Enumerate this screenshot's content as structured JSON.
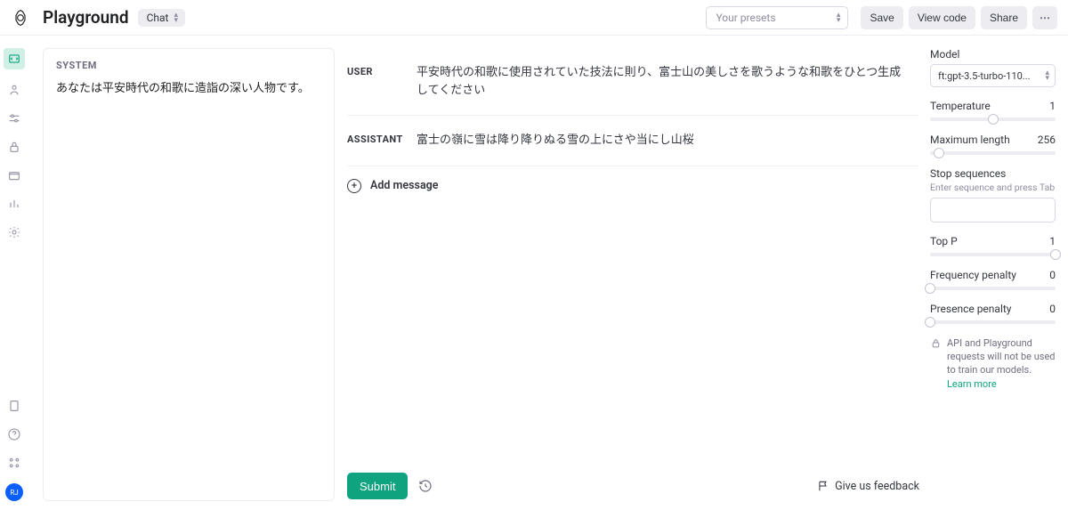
{
  "header": {
    "title": "Playground",
    "mode_label": "Chat",
    "preset_placeholder": "Your presets",
    "save_label": "Save",
    "view_code_label": "View code",
    "share_label": "Share"
  },
  "system": {
    "label": "SYSTEM",
    "text": "あなたは平安時代の和歌に造詣の深い人物です。"
  },
  "messages": [
    {
      "role": "USER",
      "text": "平安時代の和歌に使用されていた技法に則り、富士山の美しさを歌うような和歌をひとつ生成してください"
    },
    {
      "role": "ASSISTANT",
      "text": "富士の嶺に雪は降り降りぬる雪の上にさや当にし山桜"
    }
  ],
  "chat": {
    "add_message_label": "Add message",
    "submit_label": "Submit",
    "feedback_label": "Give us feedback"
  },
  "params": {
    "model": {
      "label": "Model",
      "value": "ft:gpt-3.5-turbo-110..."
    },
    "temperature": {
      "label": "Temperature",
      "value": "1",
      "pct": 50
    },
    "max_length": {
      "label": "Maximum length",
      "value": "256",
      "pct": 7
    },
    "stop_seq": {
      "label": "Stop sequences",
      "help": "Enter sequence and press Tab"
    },
    "top_p": {
      "label": "Top P",
      "value": "1",
      "pct": 100
    },
    "freq_pen": {
      "label": "Frequency penalty",
      "value": "0",
      "pct": 0
    },
    "pres_pen": {
      "label": "Presence penalty",
      "value": "0",
      "pct": 0
    },
    "notice_text": "API and Playground requests will not be used to train our models. ",
    "notice_link": "Learn more"
  },
  "avatar_initials": "RJ"
}
